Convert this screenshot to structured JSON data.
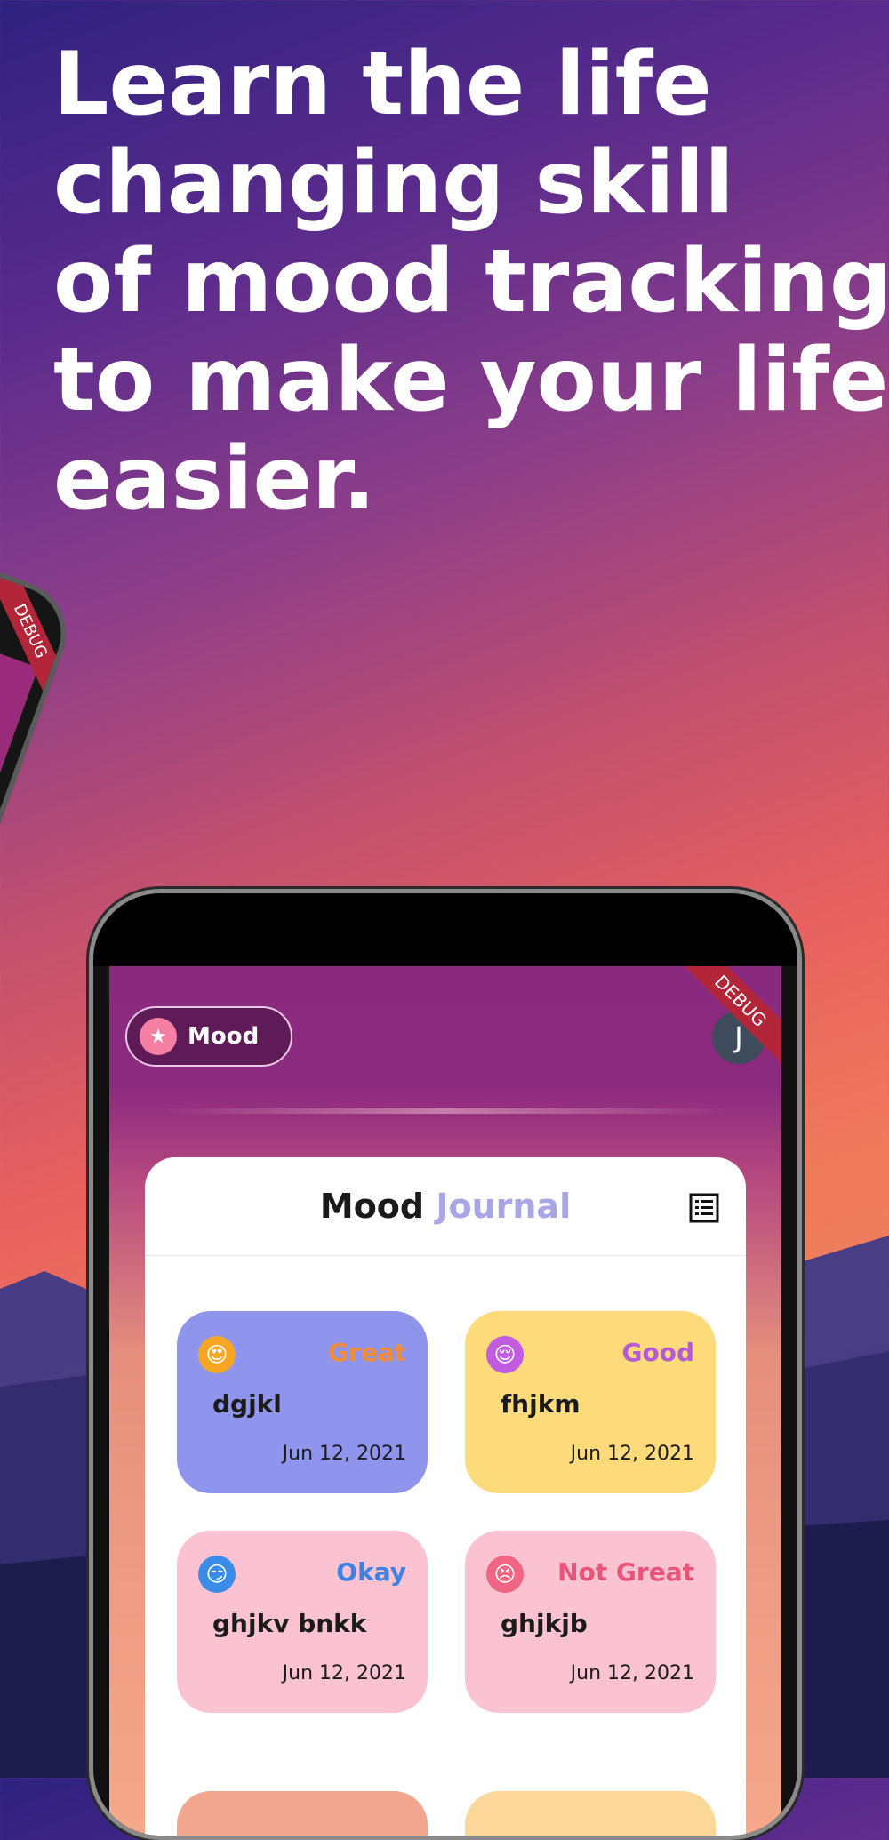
{
  "headline": {
    "lines": [
      "Learn the life",
      "changing skill",
      "of mood tracking",
      "to make your life",
      "easier."
    ]
  },
  "left_phone": {
    "debug_banner": "DEBUG"
  },
  "app": {
    "debug_banner": "DEBUG",
    "mood_chip": {
      "label": "Mood",
      "icon": "star-eyes-emoji-icon"
    },
    "avatar_initial": "J",
    "journal": {
      "title_main": "Mood",
      "title_accent": "Journal",
      "list_icon": "list-view-icon",
      "entries": [
        {
          "mood": "Great",
          "title": "dgjkl",
          "date": "Jun 12, 2021",
          "card_color": "#8f95ec",
          "mood_color": "#f08c3f",
          "emoji_color": "#f5a623",
          "emoji": "😍"
        },
        {
          "mood": "Good",
          "title": "fhjkm",
          "date": "Jun 12, 2021",
          "card_color": "#fddb7b",
          "mood_color": "#b65ad6",
          "emoji_color": "#c15be0",
          "emoji": "😌"
        },
        {
          "mood": "Okay",
          "title": "ghjkv bnkk",
          "date": "Jun 12, 2021",
          "card_color": "#fbc2d1",
          "mood_color": "#3f82e6",
          "emoji_color": "#3b8be8",
          "emoji": "😏"
        },
        {
          "mood": "Not Great",
          "title": "ghjkjb",
          "date": "Jun 12, 2021",
          "card_color": "#fbc2d1",
          "mood_color": "#e8547a",
          "emoji_color": "#f06584",
          "emoji": "😣"
        }
      ],
      "peek_colors": [
        "#f2a58f",
        "#fbd79a"
      ]
    }
  },
  "colors": {
    "primary_purple": "#8a2a7e",
    "debug_red": "#b3263a"
  }
}
